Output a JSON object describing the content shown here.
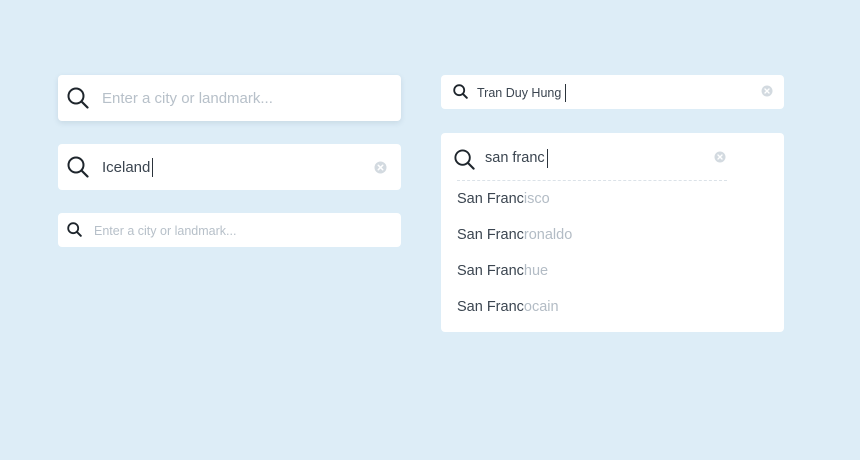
{
  "colors": {
    "background": "#ddedf7",
    "box": "#ffffff",
    "text": "#3b4550",
    "placeholder": "#b7c0c9",
    "suggestion_rest": "#b3bcc5",
    "clear_icon": "#d3dae0"
  },
  "search_large_empty": {
    "icon": "search-icon",
    "placeholder": "Enter a city or landmark..."
  },
  "search_large_filled": {
    "icon": "search-icon",
    "value": "Iceland",
    "clear_icon": "clear-icon"
  },
  "search_small_empty": {
    "icon": "search-icon",
    "placeholder": "Enter a city or landmark..."
  },
  "search_small_filled": {
    "icon": "search-icon",
    "value": "Tran Duy Hung",
    "clear_icon": "clear-icon"
  },
  "autocomplete": {
    "icon": "search-icon",
    "query": "san franc",
    "clear_icon": "clear-icon",
    "suggestions": [
      {
        "match": "San Franc",
        "rest": "isco"
      },
      {
        "match": "San Franc",
        "rest": "ronaldo"
      },
      {
        "match": "San Franc",
        "rest": "hue"
      },
      {
        "match": "San Franc",
        "rest": "ocain"
      }
    ]
  }
}
